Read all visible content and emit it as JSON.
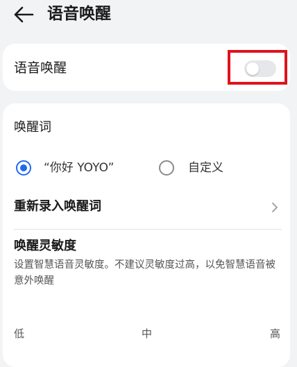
{
  "header": {
    "title": "语音唤醒"
  },
  "toggle_card": {
    "label": "语音唤醒",
    "enabled": false
  },
  "wake_word": {
    "title": "唤醒词",
    "options": [
      {
        "label": "“你好 YOYO”",
        "selected": true
      },
      {
        "label": "自定义",
        "selected": false
      }
    ],
    "rerecord_label": "重新录入唤醒词"
  },
  "sensitivity": {
    "title": "唤醒灵敏度",
    "description": "设置智慧语音灵敏度。不建议灵敏度过高，以免智慧语音被意外唤醒",
    "levels": [
      "低",
      "中",
      "高"
    ]
  },
  "colors": {
    "accent": "#1f6af0",
    "highlight": "#e0121c",
    "background": "#f1f3f5"
  },
  "icons": {
    "back": "arrow-left-icon",
    "chevron": "chevron-right-icon"
  }
}
